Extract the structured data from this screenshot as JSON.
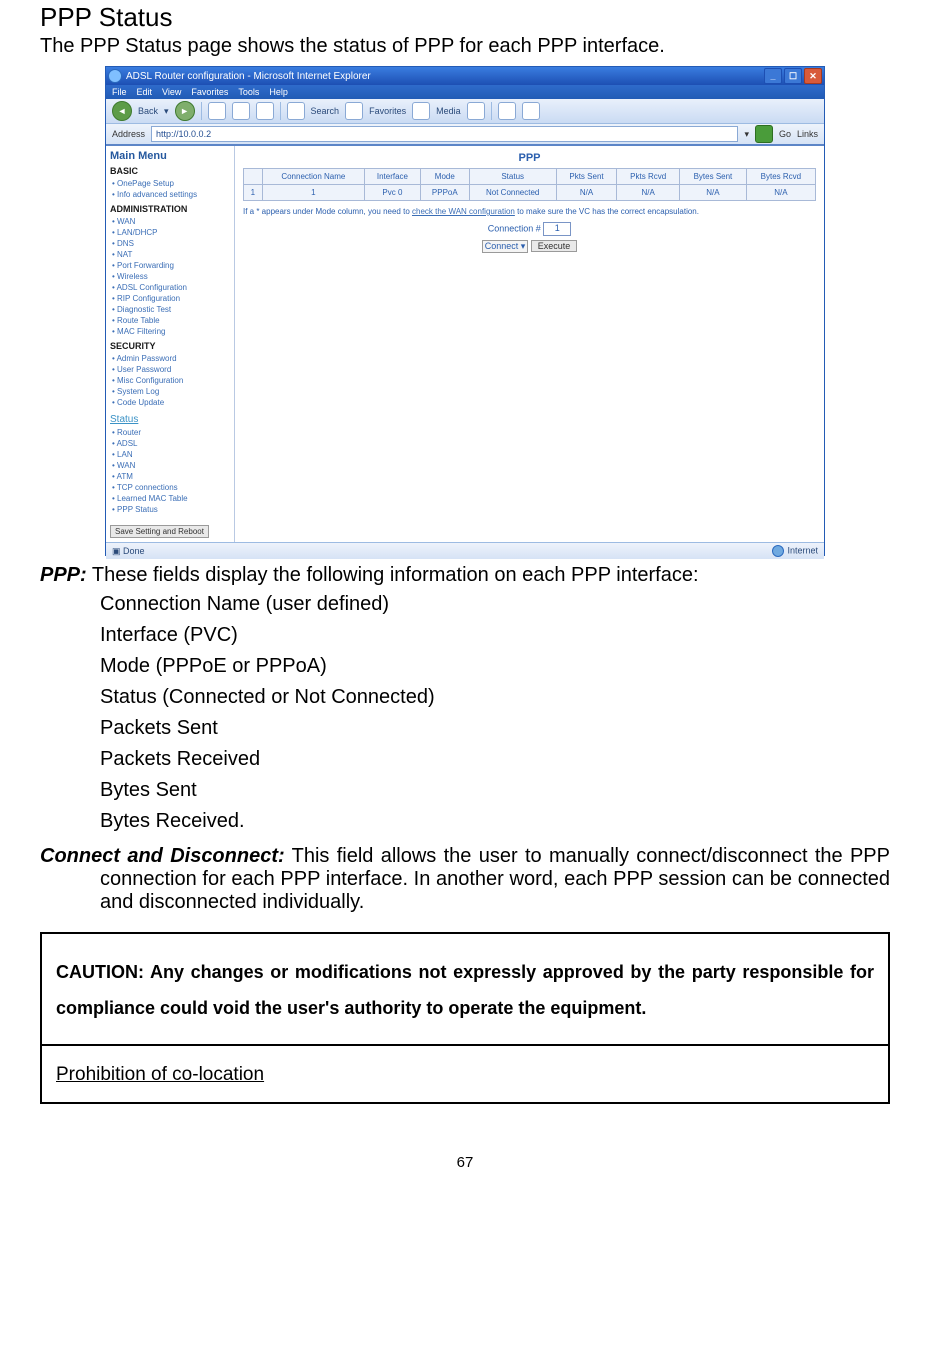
{
  "heading": "PPP Status",
  "intro": "The PPP Status page shows the status of PPP for each PPP interface.",
  "screenshot": {
    "title": "ADSL Router configuration - Microsoft Internet Explorer",
    "menus": [
      "File",
      "Edit",
      "View",
      "Favorites",
      "Tools",
      "Help"
    ],
    "toolbar": {
      "back": "Back",
      "search": "Search",
      "favorites": "Favorites",
      "media": "Media"
    },
    "address_label": "Address",
    "address_url": "http://10.0.0.2",
    "links_label": "Links",
    "sidebar": {
      "title": "Main Menu",
      "sections": {
        "basic_head": "BASIC",
        "basic_items": [
          "OnePage Setup",
          "Info advanced settings"
        ],
        "admin_head": "ADMINISTRATION",
        "admin_items": [
          "WAN",
          "LAN/DHCP",
          "DNS",
          "NAT",
          "Port Forwarding",
          "Wireless",
          "ADSL Configuration",
          "RIP Configuration",
          "Diagnostic Test",
          "Route Table",
          "MAC Filtering"
        ],
        "security_head": "SECURITY",
        "security_items": [
          "Admin Password",
          "User Password",
          "Misc Configuration",
          "System Log",
          "Code Update"
        ],
        "status_head": "Status",
        "status_items": [
          "Router",
          "ADSL",
          "LAN",
          "WAN",
          "ATM",
          "TCP connections",
          "Learned MAC Table",
          "PPP Status"
        ]
      },
      "save_btn": "Save Setting and Reboot"
    },
    "main": {
      "title": "PPP",
      "columns": [
        "",
        "Connection Name",
        "Interface",
        "Mode",
        "Status",
        "Pkts Sent",
        "Pkts Rcvd",
        "Bytes Sent",
        "Bytes Rcvd"
      ],
      "row": {
        "idx": "1",
        "name": "1",
        "iface": "Pvc 0",
        "mode": "PPPoA",
        "status": "Not Connected",
        "pks": "N/A",
        "pkr": "N/A",
        "bys": "N/A",
        "byr": "N/A"
      },
      "note_pre": "If a * appears under Mode column, you need to ",
      "note_link": "check the WAN configuration",
      "note_post": " to make sure the VC has the correct encapsulation.",
      "conn_label": "Connection #",
      "conn_value": "1",
      "action_select_label": "Connect ▾",
      "exec_btn": "Execute"
    },
    "status_bar": {
      "done": "Done",
      "zone": "Internet"
    }
  },
  "ppp_label": "PPP:",
  "ppp_text": " These fields display the following information on each PPP interface:",
  "bullets": [
    "Connection Name (user defined)",
    "Interface (PVC)",
    "Mode (PPPoE or PPPoA)",
    "Status (Connected or Not Connected)",
    "Packets Sent",
    "Packets Received",
    "Bytes Sent",
    "Bytes Received."
  ],
  "connect_label": "Connect and Disconnect:",
  "connect_text": " This field allows the user to manually connect/disconnect the PPP connection for each PPP interface. In another word, each PPP session can be connected and disconnected individually.",
  "caution": "CAUTION: Any changes or modifications not expressly approved by the party responsible for compliance could void the user's authority to operate the equipment.",
  "prohibition": "Prohibition of co-location",
  "page_number": "67"
}
